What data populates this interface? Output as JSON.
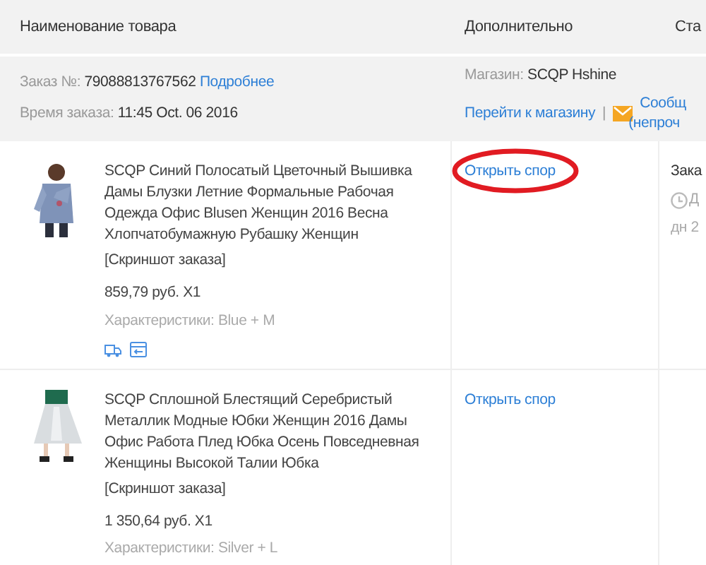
{
  "columns": [
    "Наименование товара",
    "Дополнительно",
    "Ста"
  ],
  "order": {
    "number_label": "Заказ №:",
    "number": "79088813767562",
    "details_link": "Подробнее",
    "time_label": "Время заказа:",
    "time": "11:45 Oct. 06 2016",
    "store_label": "Магазин:",
    "store": "SCQP Hshine",
    "store_link": "Перейти к магазину",
    "separator": "|",
    "message_link": "Сообщ",
    "message_note": "(непроч"
  },
  "items": [
    {
      "title": "SCQP Синий Полосатый Цветочный Вышивка Дамы Блузки Летние Формальные Рабочая Одежда Офис Blusen Женщин 2016 Весна Хлопчатобумажную Рубашку Женщин",
      "screenshot_link": "[Скриншот заказа]",
      "price": "859,79 руб. X1",
      "specs": "Характеристики: Blue + M",
      "dispute_link": "Открыть спор",
      "circled": true,
      "status": "Зака",
      "status_time": "Д",
      "status_days": "дн 2"
    },
    {
      "title": "SCQP Сплошной Блестящий Серебристый Металлик Модные Юбки Женщин 2016 Дамы Офис Работа Плед Юбка Осень Повседневная Женщины Высокой Талии Юбка",
      "screenshot_link": "[Скриншот заказа]",
      "price": "1 350,64 руб. X1",
      "specs": "Характеристики: Silver + L",
      "dispute_link": "Открыть спор",
      "circled": false
    }
  ]
}
